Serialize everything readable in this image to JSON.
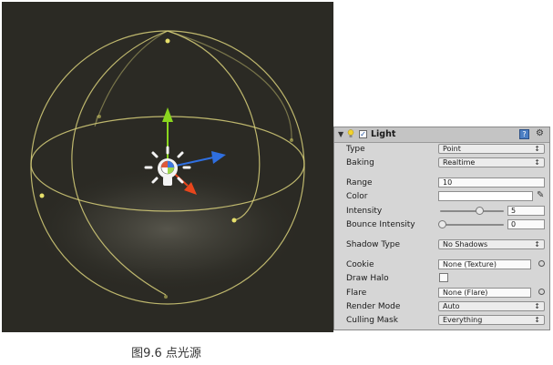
{
  "component": {
    "title": "Light",
    "help_icon": "help-icon",
    "settings_icon": "gear-icon"
  },
  "fields": {
    "type": {
      "label": "Type",
      "value": "Point"
    },
    "baking": {
      "label": "Baking",
      "value": "Realtime"
    },
    "range": {
      "label": "Range",
      "value": "10"
    },
    "color": {
      "label": "Color",
      "value": "#ffffff"
    },
    "intensity": {
      "label": "Intensity",
      "value": "5",
      "slider_fraction": 0.625
    },
    "bounce_intensity": {
      "label": "Bounce Intensity",
      "value": "0",
      "slider_fraction": 0.0
    },
    "shadow_type": {
      "label": "Shadow Type",
      "value": "No Shadows"
    },
    "cookie": {
      "label": "Cookie",
      "value": "None (Texture)"
    },
    "draw_halo": {
      "label": "Draw Halo",
      "checked": false
    },
    "flare": {
      "label": "Flare",
      "value": "None (Flare)"
    },
    "render_mode": {
      "label": "Render Mode",
      "value": "Auto"
    },
    "culling_mask": {
      "label": "Culling Mask",
      "value": "Everything"
    }
  },
  "caption": "图9.6 点光源",
  "colors": {
    "scene_bg": "#2b2a24",
    "gizmo_wire": "#d8d07a",
    "axis_x": "#e8461c",
    "axis_y": "#8ad61e",
    "axis_z": "#2f6fe0"
  }
}
